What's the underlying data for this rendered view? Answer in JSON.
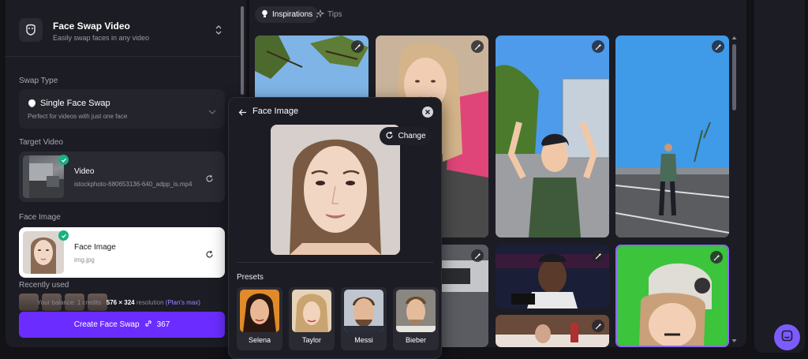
{
  "app": {
    "title": "Face Swap Video",
    "subtitle": "Easily swap faces in any video"
  },
  "swap_type": {
    "label": "Swap Type",
    "value": "Single Face Swap",
    "description": "Perfect for videos with just one face"
  },
  "target_video": {
    "label": "Target Video",
    "title": "Video",
    "file": "istockphoto-680653136-640_adpp_is.mp4"
  },
  "face_image": {
    "label": "Face Image",
    "title": "Face Image",
    "file": "img.jpg"
  },
  "recently_used": {
    "label": "Recently used"
  },
  "balance": {
    "prefix": "Your balance:",
    "credits": "1 credits",
    "resolution": "576 × 324",
    "resolution_label": "resolution",
    "plan": "(Plan's max)"
  },
  "create_button": {
    "label": "Create Face Swap",
    "cost": "367"
  },
  "tabs": [
    {
      "label": "Inspirations",
      "active": true,
      "icon": "bulb-icon"
    },
    {
      "label": "Tips",
      "active": false,
      "icon": "sparkle-icon"
    }
  ],
  "popup": {
    "title": "Face Image",
    "change_label": "Change",
    "presets_label": "Presets",
    "presets": [
      {
        "name": "Selena"
      },
      {
        "name": "Taylor"
      },
      {
        "name": "Messi"
      },
      {
        "name": "Bieber"
      }
    ]
  },
  "colors": {
    "accent": "#6b2dff",
    "success": "#19b07e",
    "panel": "#1c1c24",
    "background": "#121217",
    "chat": "#7c5cff"
  },
  "icons": [
    "mask-icon",
    "chevron-updown-icon",
    "shield-icon",
    "refresh-icon",
    "check-icon",
    "link-icon",
    "wand-icon",
    "back-arrow-icon",
    "close-icon",
    "chat-icon"
  ]
}
